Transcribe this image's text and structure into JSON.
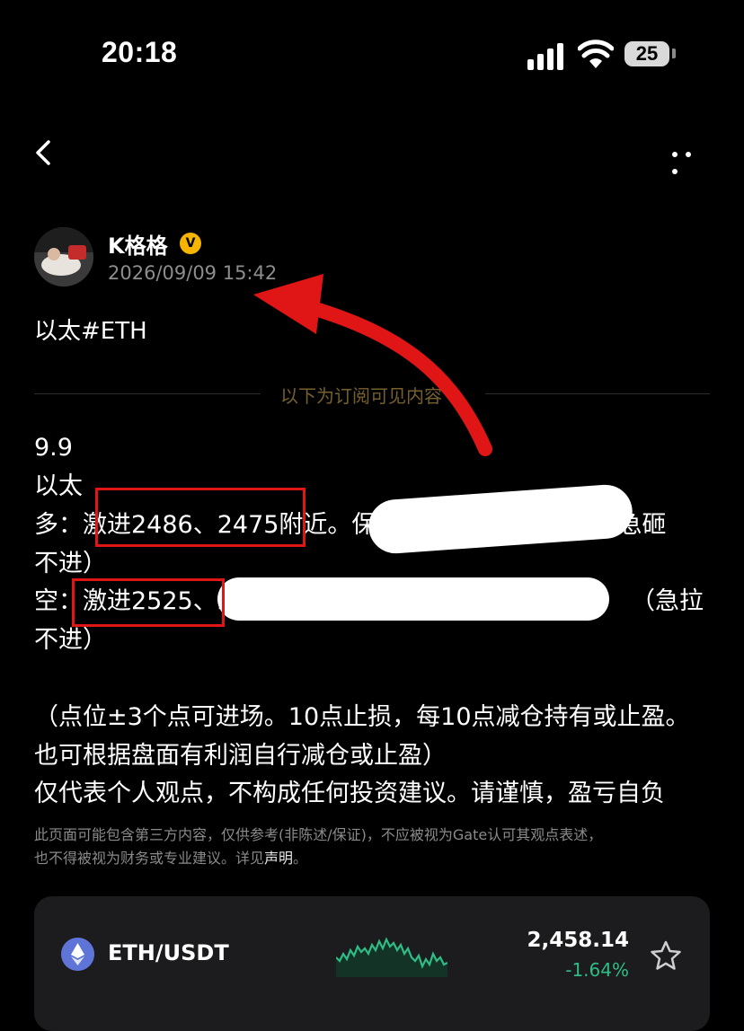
{
  "status_bar": {
    "time": "20:18",
    "battery": "25"
  },
  "post": {
    "author": "K格格",
    "verified_badge": "V",
    "timestamp": "2026/09/09 15:42",
    "title": "以太#ETH",
    "subscription_divider": "以下为订阅可见内容",
    "lines": {
      "date": "9.9",
      "asset": "以太",
      "long_prefix": "多：",
      "long_entry": "激进2486、2475附近。保",
      "long_tail": "这。（急砸",
      "long_cont": "不进）",
      "short_prefix": "空：",
      "short_entry": "激进2525、2",
      "short_tail": "（急拉",
      "short_cont": "不进）",
      "note1": "（点位±3个点可进场。10点止损，每10点减仓持有或止盈。",
      "note2": "也可根据盘面有利润自行减仓或止盈）",
      "note3": "仅代表个人观点，不构成任何投资建议。请谨慎，盈亏自负"
    },
    "disclaimer": {
      "line1": "此页面可能包含第三方内容，仅供参考(非陈述/保证)，不应被视为Gate认可其观点表述，",
      "line2": "也不得被视为财务或专业建议。详见",
      "link": "声明",
      "end": "。"
    }
  },
  "ticker": {
    "pair": "ETH/USDT",
    "price": "2,458.14",
    "change": "-1.64%",
    "change_color": "#2ebd85"
  },
  "colors": {
    "annotation_red": "#e01616",
    "accent_gold": "#75602e"
  }
}
